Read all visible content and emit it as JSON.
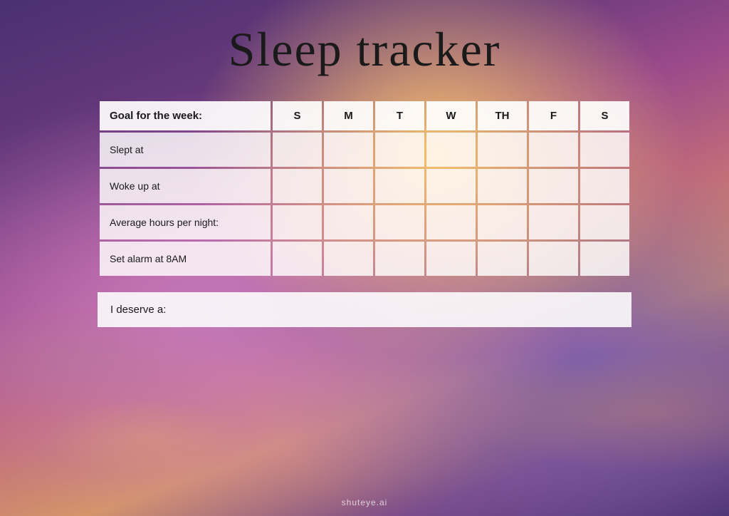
{
  "title": "Sleep tracker",
  "table": {
    "header": {
      "label": "Goal for the week:",
      "days": [
        "S",
        "M",
        "T",
        "W",
        "TH",
        "F",
        "S"
      ]
    },
    "rows": [
      {
        "label": "Slept at",
        "cells": [
          "",
          "",
          "",
          "",
          "",
          "",
          ""
        ]
      },
      {
        "label": "Woke up at",
        "cells": [
          "",
          "",
          "",
          "",
          "",
          "",
          ""
        ]
      },
      {
        "label": "Average hours per night:",
        "cells": [
          "",
          "",
          "",
          "",
          "",
          "",
          ""
        ]
      },
      {
        "label": "Set alarm at 8AM",
        "cells": [
          "",
          "",
          "",
          "",
          "",
          "",
          ""
        ]
      }
    ]
  },
  "deserve_label": "I deserve a:",
  "footer": "shuteye.ai"
}
